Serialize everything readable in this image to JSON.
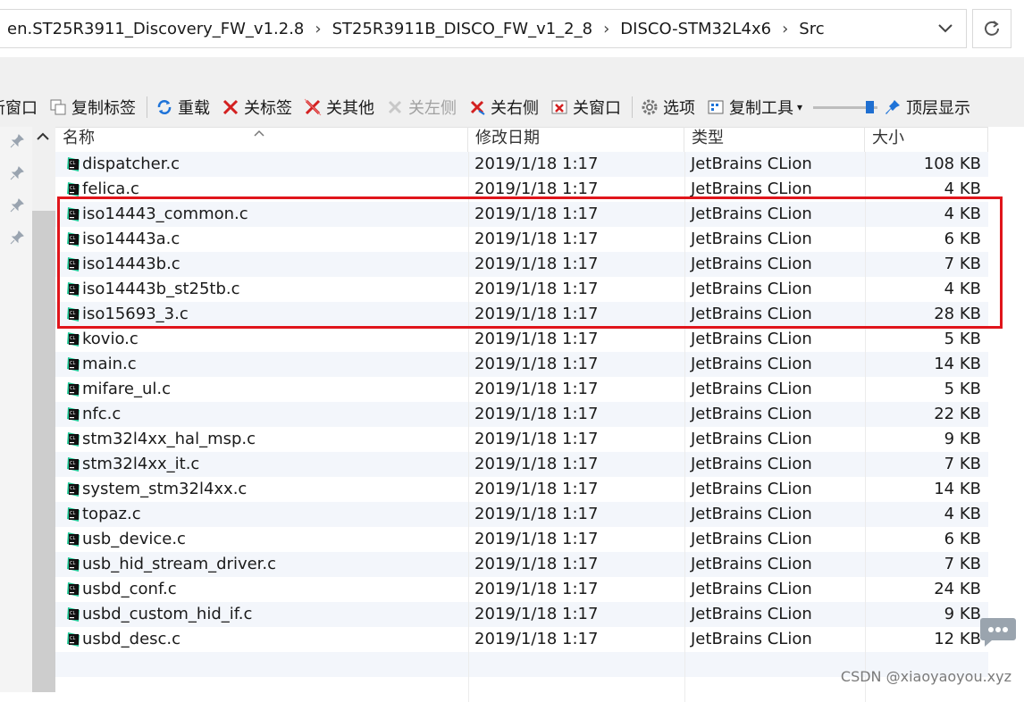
{
  "address": {
    "crumbs": [
      "en.ST25R3911_Discovery_FW_v1.2.8",
      "ST25R3911B_DISCO_FW_v1_2_8",
      "DISCO-STM32L4x6",
      "Src"
    ],
    "dropdown_icon": "chevron-down-icon",
    "refresh_icon": "refresh-icon"
  },
  "toolbar": {
    "new_window": "新窗口",
    "copy_tab": "复制标签",
    "reload": "重载",
    "close_tab": "关标签",
    "close_others": "关其他",
    "close_left": "关左侧",
    "close_right": "关右侧",
    "close_window": "关窗口",
    "options": "选项",
    "copy_tool": "复制工具",
    "dropdown_marker": "▾",
    "opacity_level_percent": 95,
    "topmost": "顶层显示"
  },
  "columns": {
    "name": "名称",
    "date": "修改日期",
    "type": "类型",
    "size": "大小"
  },
  "files": [
    {
      "name": "dispatcher.c",
      "date": "2019/1/18 1:17",
      "type": "JetBrains CLion",
      "size": "108 KB"
    },
    {
      "name": "felica.c",
      "date": "2019/1/18 1:17",
      "type": "JetBrains CLion",
      "size": "4 KB"
    },
    {
      "name": "iso14443_common.c",
      "date": "2019/1/18 1:17",
      "type": "JetBrains CLion",
      "size": "4 KB"
    },
    {
      "name": "iso14443a.c",
      "date": "2019/1/18 1:17",
      "type": "JetBrains CLion",
      "size": "6 KB"
    },
    {
      "name": "iso14443b.c",
      "date": "2019/1/18 1:17",
      "type": "JetBrains CLion",
      "size": "7 KB"
    },
    {
      "name": "iso14443b_st25tb.c",
      "date": "2019/1/18 1:17",
      "type": "JetBrains CLion",
      "size": "4 KB"
    },
    {
      "name": "iso15693_3.c",
      "date": "2019/1/18 1:17",
      "type": "JetBrains CLion",
      "size": "28 KB"
    },
    {
      "name": "kovio.c",
      "date": "2019/1/18 1:17",
      "type": "JetBrains CLion",
      "size": "5 KB"
    },
    {
      "name": "main.c",
      "date": "2019/1/18 1:17",
      "type": "JetBrains CLion",
      "size": "14 KB"
    },
    {
      "name": "mifare_ul.c",
      "date": "2019/1/18 1:17",
      "type": "JetBrains CLion",
      "size": "5 KB"
    },
    {
      "name": "nfc.c",
      "date": "2019/1/18 1:17",
      "type": "JetBrains CLion",
      "size": "22 KB"
    },
    {
      "name": "stm32l4xx_hal_msp.c",
      "date": "2019/1/18 1:17",
      "type": "JetBrains CLion",
      "size": "9 KB"
    },
    {
      "name": "stm32l4xx_it.c",
      "date": "2019/1/18 1:17",
      "type": "JetBrains CLion",
      "size": "7 KB"
    },
    {
      "name": "system_stm32l4xx.c",
      "date": "2019/1/18 1:17",
      "type": "JetBrains CLion",
      "size": "14 KB"
    },
    {
      "name": "topaz.c",
      "date": "2019/1/18 1:17",
      "type": "JetBrains CLion",
      "size": "4 KB"
    },
    {
      "name": "usb_device.c",
      "date": "2019/1/18 1:17",
      "type": "JetBrains CLion",
      "size": "6 KB"
    },
    {
      "name": "usb_hid_stream_driver.c",
      "date": "2019/1/18 1:17",
      "type": "JetBrains CLion",
      "size": "7 KB"
    },
    {
      "name": "usbd_conf.c",
      "date": "2019/1/18 1:17",
      "type": "JetBrains CLion",
      "size": "24 KB"
    },
    {
      "name": "usbd_custom_hid_if.c",
      "date": "2019/1/18 1:17",
      "type": "JetBrains CLion",
      "size": "9 KB"
    },
    {
      "name": "usbd_desc.c",
      "date": "2019/1/18 1:17",
      "type": "JetBrains CLion",
      "size": "12 KB"
    }
  ],
  "highlight_color": "#e0151b",
  "watermark": "CSDN @xiaoyaoyou.xyz"
}
